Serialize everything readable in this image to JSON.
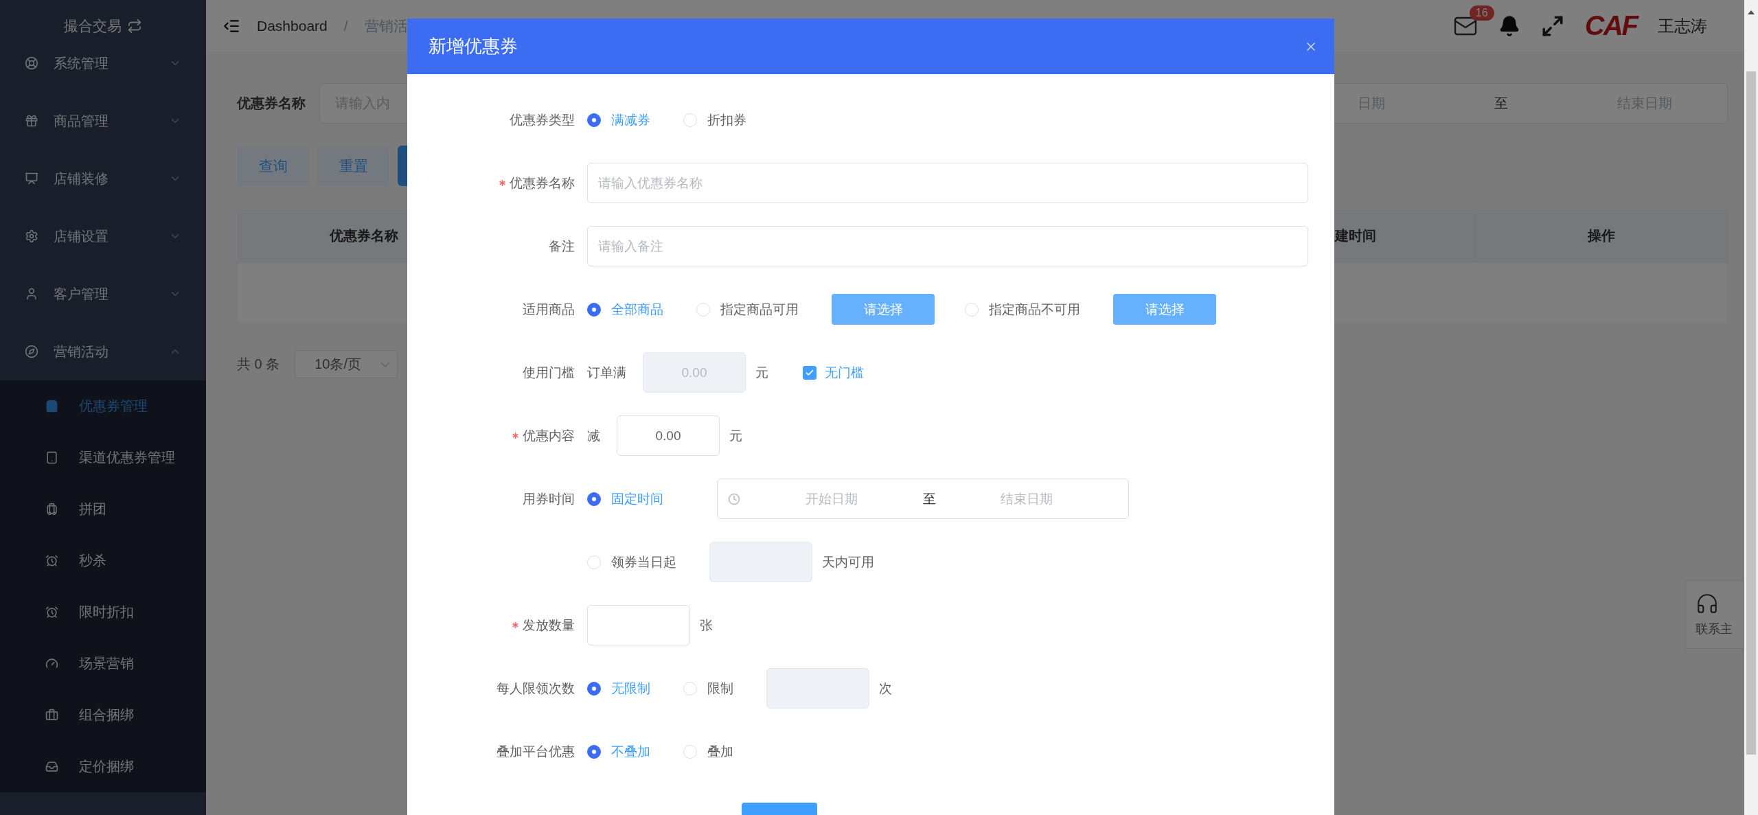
{
  "sidebar": {
    "title": "撮合交易",
    "items": [
      {
        "label": "系统管理",
        "expanded": false
      },
      {
        "label": "商品管理",
        "expanded": false
      },
      {
        "label": "店铺装修",
        "expanded": false
      },
      {
        "label": "店铺设置",
        "expanded": false
      },
      {
        "label": "客户管理",
        "expanded": false
      },
      {
        "label": "营销活动",
        "expanded": true,
        "children": [
          {
            "label": "优惠券管理",
            "selected": true
          },
          {
            "label": "渠道优惠券管理",
            "selected": false
          },
          {
            "label": "拼团",
            "selected": false
          },
          {
            "label": "秒杀",
            "selected": false
          },
          {
            "label": "限时折扣",
            "selected": false
          },
          {
            "label": "场景营销",
            "selected": false
          },
          {
            "label": "组合捆绑",
            "selected": false
          },
          {
            "label": "定价捆绑",
            "selected": false
          }
        ]
      }
    ]
  },
  "header": {
    "breadcrumb": [
      "Dashboard",
      "营销活"
    ],
    "breadcrumb_separator": "/",
    "mail_badge": "16",
    "logo": "CAF",
    "user": "王志涛"
  },
  "filter": {
    "label": "优惠券名称",
    "placeholder": "请输入内",
    "date_start_placeholder": "日期",
    "date_separator": "至",
    "date_end_placeholder": "结束日期"
  },
  "actions": [
    "查询",
    "重置"
  ],
  "table": {
    "columns": [
      "优惠券名称",
      "",
      "建时间",
      "操作"
    ]
  },
  "pagination": {
    "total": "共 0 条",
    "page_size": "10条/页"
  },
  "contact": {
    "label": "联系主"
  },
  "dialog": {
    "title": "新增优惠券",
    "rows": [
      {
        "label": "优惠券类型",
        "required": false,
        "controls": [
          {
            "kind": "radio",
            "label": "满减券",
            "selected": true
          },
          {
            "kind": "radio",
            "label": "折扣券",
            "selected": false
          }
        ]
      },
      {
        "label": "优惠券名称",
        "required": true,
        "controls": [
          {
            "kind": "field",
            "placeholder": "请输入优惠券名称"
          }
        ]
      },
      {
        "label": "备注",
        "required": false,
        "controls": [
          {
            "kind": "field",
            "placeholder": "请输入备注"
          }
        ]
      },
      {
        "label": "适用商品",
        "required": false,
        "controls": [
          {
            "kind": "radio",
            "label": "全部商品",
            "selected": true
          },
          {
            "kind": "radio",
            "label": "指定商品可用",
            "selected": false
          },
          {
            "kind": "button",
            "label": "请选择"
          },
          {
            "kind": "radio",
            "label": "指定商品不可用",
            "selected": false
          },
          {
            "kind": "button",
            "label": "请选择"
          }
        ]
      },
      {
        "label": "使用门槛",
        "required": false,
        "controls": [
          {
            "kind": "text",
            "text": "订单满"
          },
          {
            "kind": "box",
            "value": "0.00",
            "disabled": true
          },
          {
            "kind": "text",
            "text": "元"
          },
          {
            "kind": "checkbox",
            "label": "无门槛",
            "checked": true
          }
        ]
      },
      {
        "label": "优惠内容",
        "required": true,
        "controls": [
          {
            "kind": "text",
            "text": "减"
          },
          {
            "kind": "box",
            "value": "0.00",
            "disabled": false
          },
          {
            "kind": "text",
            "text": "元"
          }
        ]
      },
      {
        "label": "用券时间",
        "required": false,
        "controls": [
          {
            "kind": "radio",
            "label": "固定时间",
            "selected": true
          },
          {
            "kind": "daterange",
            "start_placeholder": "开始日期",
            "separator": "至",
            "end_placeholder": "结束日期"
          }
        ]
      },
      {
        "controls": [
          {
            "kind": "radio",
            "label": "领券当日起",
            "selected": false
          },
          {
            "kind": "box",
            "disabled": true
          },
          {
            "kind": "text",
            "text": "天内可用"
          }
        ]
      },
      {
        "label": "发放数量",
        "required": true,
        "controls": [
          {
            "kind": "box",
            "disabled": false
          },
          {
            "kind": "text",
            "text": "张"
          }
        ]
      },
      {
        "label": "每人限领次数",
        "required": false,
        "controls": [
          {
            "kind": "radio",
            "label": "无限制",
            "selected": true
          },
          {
            "kind": "radio",
            "label": "限制",
            "selected": false
          },
          {
            "kind": "box",
            "disabled": true
          },
          {
            "kind": "text",
            "text": "次"
          }
        ]
      },
      {
        "label": "叠加平台优惠",
        "required": false,
        "controls": [
          {
            "kind": "radio",
            "label": "不叠加",
            "selected": true
          },
          {
            "kind": "radio",
            "label": "叠加",
            "selected": false
          }
        ]
      }
    ]
  }
}
